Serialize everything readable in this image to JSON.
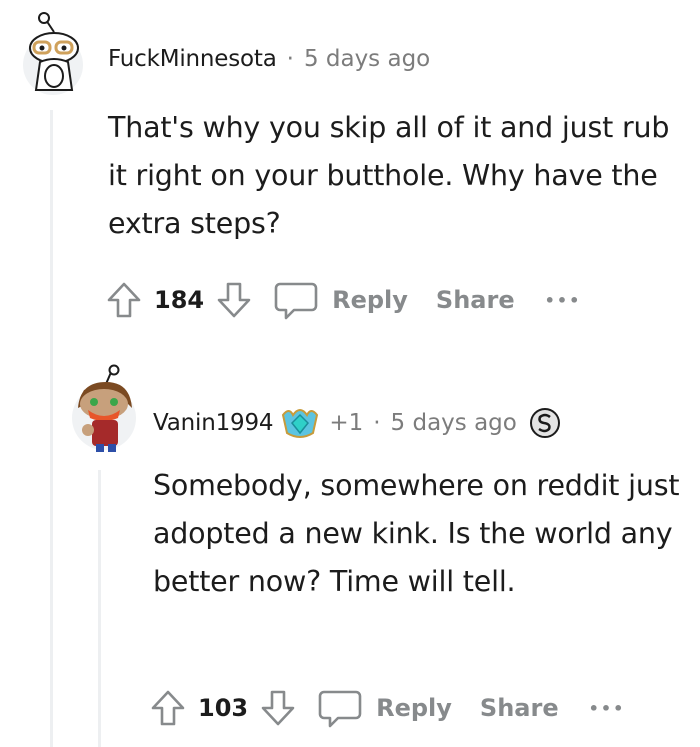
{
  "comments": [
    {
      "username": "FuckMinnesota",
      "timestamp": "5 days ago",
      "body": "That's why you skip all of it and just rub it right on your butthole. Why have the extra steps?",
      "votes": "184",
      "reply_label": "Reply",
      "share_label": "Share",
      "more_label": "•••"
    },
    {
      "username": "Vanin1994",
      "award_count": "+1",
      "timestamp": "5 days ago",
      "body": "Somebody, somewhere on reddit just adopted a new kink. Is the world any better now? Time will tell.",
      "votes": "103",
      "reply_label": "Reply",
      "share_label": "Share",
      "more_label": "•••"
    }
  ],
  "colors": {
    "text": "#1c1c1c",
    "muted": "#878a8c",
    "thread_line": "#edeff1"
  }
}
